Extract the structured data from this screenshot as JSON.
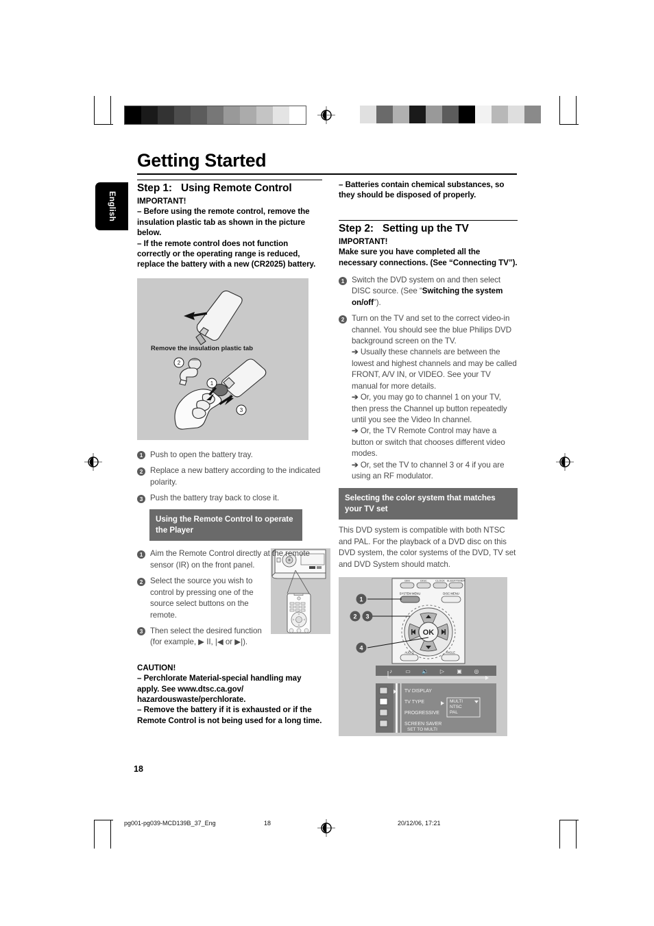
{
  "document": {
    "page_title": "Getting Started",
    "language_tab": "English",
    "page_number": "18"
  },
  "colophon": {
    "filename": "pg001-pg039-MCD139B_37_Eng",
    "page": "18",
    "timestamp": "20/12/06, 17:21"
  },
  "left_column": {
    "step1_heading_label": "Step 1:",
    "step1_heading_title": "Using Remote Control",
    "important_label": "IMPORTANT!",
    "important_bullets": [
      "–  Before using the remote control, remove the insulation plastic tab as shown in the picture below.",
      "–  If the remote control does not function correctly or the operating range is reduced, replace the battery with a new (CR2025) battery."
    ],
    "figure_battery": {
      "caption": "Remove the insulation plastic tab",
      "callout_1": "1",
      "callout_2": "2",
      "callout_3": "3"
    },
    "battery_steps": [
      {
        "num": "1",
        "text": "Push to open the battery tray."
      },
      {
        "num": "2",
        "text": "Replace a new battery according to the indicated polarity."
      },
      {
        "num": "3",
        "text": "Push the battery tray back to close it."
      }
    ],
    "using_remote_heading": "Using the Remote Control to operate the Player",
    "using_remote_steps": [
      {
        "num": "1",
        "text": "Aim the Remote Control directly at the remote sensor (IR) on the front panel."
      },
      {
        "num": "2",
        "text": "Select the source you wish to control by pressing one of the source select buttons on the remote."
      },
      {
        "num": "3",
        "text": "Then select the desired function (for example, ▶ II, |◀ or ▶|)."
      }
    ],
    "caution_label": "CAUTION!",
    "caution_bullets": [
      "–  Perchlorate Material-special handling may apply. See www.dtsc.ca.gov/ hazardouswaste/perchlorate.",
      "–  Remove the battery if it is exhausted or if the Remote Control is not being used for a long time."
    ]
  },
  "right_column": {
    "battery_disposal_bullet": "–  Batteries contain chemical substances, so they should be disposed of properly.",
    "step2_heading_label": "Step 2:",
    "step2_heading_title": "Setting up the TV",
    "important_label": "IMPORTANT!",
    "important_text": "Make sure you have completed all the necessary connections. (See “Connecting TV”).",
    "tv_steps": [
      {
        "num": "1",
        "text_before": "Switch the DVD system on and then select DISC source. (See “",
        "text_bold": "Switching the system on/off",
        "text_after": "”)."
      },
      {
        "num": "2",
        "text": "Turn on the TV and set to the correct video-in channel. You should see the blue Philips DVD background screen on the TV.",
        "arrows": [
          "Usually these channels are between the lowest and highest channels and may be called FRONT, A/V IN, or VIDEO. See your TV manual for more details.",
          "Or, you may go to channel 1 on your TV, then press the Channel up button repeatedly until you see the Video In channel.",
          "Or, the TV Remote Control may have a button or switch that chooses different video modes.",
          "Or, set the TV to channel 3 or 4 if you are using an RF modulator."
        ]
      }
    ],
    "color_system_heading": "Selecting the color system that matches your TV set",
    "color_system_text": "This DVD system is compatible with both NTSC and PAL. For the playback of a DVD disc on this DVD system, the color systems of the DVD, TV set and DVD System should match.",
    "figure_tvsetup": {
      "callouts": [
        "1",
        "2",
        "3",
        "4"
      ],
      "remote_button_labels": {
        "system_menu": "SYSTEM MENU",
        "ok": "OK",
        "top_row": [
          "DIM",
          "DISC",
          "CLOCK",
          "SLEEP/TIMER"
        ],
        "right": [
          "DISC MENU"
        ],
        "bottom_left": "AUDIO",
        "bottom_right": "ANGLE"
      },
      "osd_menu": {
        "icons": [
          "disc-icon",
          "tv-icon",
          "audio-icon",
          "play-icon",
          "video-icon",
          "preference-icon"
        ],
        "rows": [
          "TV DISPLAY",
          "TV TYPE",
          "PROGRESSIVE",
          "SCREEN SAVER"
        ],
        "selected_row": "TV TYPE",
        "dropdown_value": "MULTI",
        "dropdown_options": [
          "MULTI",
          "NTSC",
          "PAL"
        ],
        "status_text": "SET TO MULTI"
      }
    }
  },
  "colors": {
    "illustration_bg": "#c9c9c9",
    "gray_heading_bg": "#6a6a6a",
    "body_text": "#4a4a4a",
    "osd_bg": "#8a8a8a",
    "osd_panel": "#6f6f6f"
  },
  "print_marks": {
    "grayscale_left": [
      "#000000",
      "#1a1a1a",
      "#333333",
      "#4d4d4d",
      "#5c5c5c",
      "#777777",
      "#999999",
      "#ababab",
      "#c4c4c4",
      "#e4e4e4",
      "#ffffff"
    ],
    "grayscale_right": [
      "#e0e0e0",
      "#6a6a6a",
      "#b0b0b0",
      "#1a1a1a",
      "#999999",
      "#5c5c5c",
      "#000000",
      "#f2f2f2",
      "#b8b8b8",
      "#dedede",
      "#8a8a8a"
    ]
  }
}
